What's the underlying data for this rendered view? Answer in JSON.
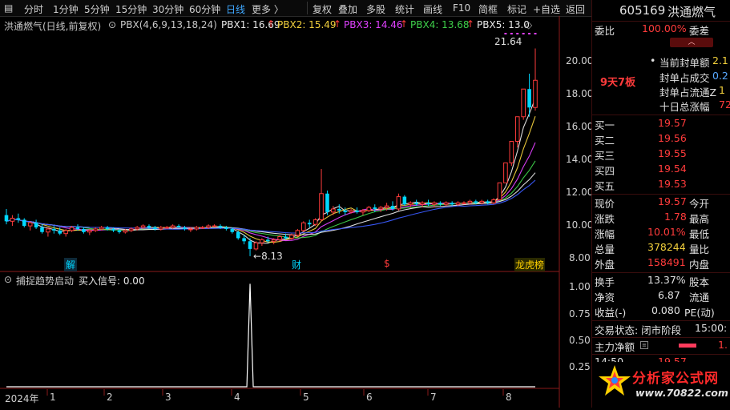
{
  "toolbar": {
    "left_items": [
      "分时",
      "1分钟",
      "5分钟",
      "15分钟",
      "30分钟",
      "60分钟",
      "日线",
      "更多 〉"
    ],
    "active_index": 6,
    "right_items": [
      "复权",
      "叠加",
      "多股",
      "统计",
      "画线",
      "F10",
      "简框",
      "标记",
      "+自选",
      "返回"
    ]
  },
  "main_header": {
    "title": "洪通燃气(日线,前复权)",
    "formula": "PBX(4,6,9,13,18,24)",
    "pbx": [
      {
        "label": "PBX1: 16.69",
        "color": "#e8e8e8"
      },
      {
        "label": "PBX2: 15.49",
        "color": "#f2d03c"
      },
      {
        "label": "PBX3: 14.46",
        "color": "#e040ff"
      },
      {
        "label": "PBX4: 13.68",
        "color": "#3ecf4a"
      },
      {
        "label": "PBX5: 13.0",
        "color": "#e8e8e8"
      }
    ]
  },
  "price_axis": {
    "ticks": [
      "20.00",
      "18.00",
      "16.00",
      "14.00",
      "12.00",
      "10.00",
      "8.00"
    ]
  },
  "annotations": {
    "high": "21.64",
    "low": "8.13"
  },
  "event_markers": [
    {
      "text": "解",
      "color": "#00d8ff"
    },
    {
      "text": "财",
      "color": "#00d8ff"
    },
    {
      "text": "$",
      "color": "#ff3b3b"
    },
    {
      "text": "龙虎榜",
      "color": "#ffd000"
    }
  ],
  "sub_header": {
    "title": "捕捉趋势启动",
    "signal": "买入信号: 0.00"
  },
  "sub_axis": {
    "ticks": [
      "1.00",
      "0.75",
      "0.50",
      "0.25"
    ]
  },
  "date_axis": {
    "ticks": [
      "2024年",
      "1",
      "2",
      "3",
      "4",
      "5",
      "6",
      "7",
      "8"
    ]
  },
  "panel": {
    "code": "605169",
    "name": "洪通燃气",
    "weibi_label": "委比",
    "weibi_value": "100.00%",
    "weicha_label": "委差",
    "streak": "9天7板",
    "limit_rows": [
      {
        "label": "当前封单额",
        "value": "2.1"
      },
      {
        "label": "封单占成交",
        "value": "0.2"
      },
      {
        "label": "封单占流通Z",
        "value": "1"
      },
      {
        "label": "十日总涨幅",
        "value": "72"
      }
    ],
    "bids": [
      {
        "label": "买一",
        "price": "19.57"
      },
      {
        "label": "买二",
        "price": "19.56"
      },
      {
        "label": "买三",
        "price": "19.55"
      },
      {
        "label": "买四",
        "price": "19.54"
      },
      {
        "label": "买五",
        "price": "19.53"
      }
    ],
    "quote": [
      {
        "l1": "现价",
        "v1": "19.57",
        "l2": "今开",
        "c": "red"
      },
      {
        "l1": "涨跌",
        "v1": "1.78",
        "l2": "最高",
        "c": "red"
      },
      {
        "l1": "涨幅",
        "v1": "10.01%",
        "l2": "最低",
        "c": "red"
      },
      {
        "l1": "总量",
        "v1": "378244",
        "l2": "量比",
        "c": "yel"
      },
      {
        "l1": "外盘",
        "v1": "158491",
        "l2": "内盘",
        "c": "red"
      }
    ],
    "stats": [
      {
        "l1": "换手",
        "v1": "13.37%",
        "l2": "股本"
      },
      {
        "l1": "净资",
        "v1": "6.87",
        "l2": "流通"
      },
      {
        "l1": "收益(-)",
        "v1": "0.080",
        "l2": "PE(动)"
      }
    ],
    "status_label": "交易状态: 闭市阶段",
    "status_time": "15:00:",
    "net_label": "主力净额",
    "net_value": "1.",
    "bottom_time": "14:50",
    "bottom_price": "19.57"
  },
  "watermark": {
    "main": "分析家公式网",
    "url": "www.70822.com"
  },
  "colors": {
    "up": "#ff3b3b",
    "down": "#00d8ff",
    "bg": "#000000",
    "grid": "#3a0d0d"
  },
  "chart_data": {
    "type": "candlestick",
    "title": "洪通燃气(日线,前复权)",
    "ylim": [
      7.5,
      22.5
    ],
    "x_ticks": [
      "2024年",
      "1",
      "2",
      "3",
      "4",
      "5",
      "6",
      "7",
      "8"
    ],
    "ohlc": [
      [
        10.8,
        11.2,
        10.2,
        10.4
      ],
      [
        10.4,
        10.8,
        10.1,
        10.6
      ],
      [
        10.6,
        10.9,
        10.3,
        10.5
      ],
      [
        10.5,
        10.6,
        10.0,
        10.1
      ],
      [
        10.1,
        10.4,
        9.8,
        10.3
      ],
      [
        10.3,
        10.5,
        9.9,
        10.0
      ],
      [
        10.0,
        10.2,
        9.6,
        9.7
      ],
      [
        9.7,
        10.0,
        9.4,
        9.9
      ],
      [
        9.9,
        10.1,
        9.6,
        9.8
      ],
      [
        9.8,
        10.0,
        9.5,
        9.6
      ],
      [
        9.6,
        9.9,
        9.4,
        9.8
      ],
      [
        9.8,
        10.1,
        9.7,
        10.0
      ],
      [
        10.0,
        10.2,
        9.8,
        9.9
      ],
      [
        9.9,
        10.0,
        9.6,
        9.7
      ],
      [
        9.7,
        9.9,
        9.5,
        9.8
      ],
      [
        9.8,
        10.0,
        9.7,
        9.9
      ],
      [
        9.9,
        10.1,
        9.8,
        10.0
      ],
      [
        10.0,
        10.1,
        9.8,
        9.9
      ],
      [
        9.9,
        10.0,
        9.7,
        9.8
      ],
      [
        9.8,
        9.9,
        9.6,
        9.7
      ],
      [
        9.7,
        9.9,
        9.6,
        9.8
      ],
      [
        9.8,
        10.0,
        9.7,
        9.9
      ],
      [
        9.9,
        10.1,
        9.8,
        10.0
      ],
      [
        10.0,
        10.2,
        9.9,
        10.1
      ],
      [
        10.1,
        10.2,
        9.9,
        10.0
      ],
      [
        10.0,
        10.1,
        9.8,
        9.9
      ],
      [
        9.9,
        10.1,
        9.8,
        10.0
      ],
      [
        10.0,
        10.1,
        9.9,
        10.0
      ],
      [
        10.0,
        10.2,
        9.9,
        10.1
      ],
      [
        10.1,
        10.2,
        10.0,
        10.0
      ],
      [
        10.0,
        10.1,
        9.8,
        9.9
      ],
      [
        9.9,
        10.0,
        9.7,
        9.9
      ],
      [
        9.9,
        10.1,
        9.8,
        10.0
      ],
      [
        10.0,
        10.1,
        9.9,
        10.0
      ],
      [
        10.0,
        10.2,
        9.9,
        10.1
      ],
      [
        10.1,
        10.2,
        10.0,
        10.1
      ],
      [
        10.1,
        10.2,
        9.9,
        10.0
      ],
      [
        10.0,
        10.1,
        9.8,
        9.9
      ],
      [
        9.9,
        10.0,
        9.6,
        9.7
      ],
      [
        9.7,
        9.8,
        9.2,
        9.3
      ],
      [
        9.3,
        9.5,
        8.9,
        9.1
      ],
      [
        9.1,
        9.3,
        8.13,
        8.6
      ],
      [
        8.6,
        9.1,
        8.5,
        9.0
      ],
      [
        9.0,
        9.3,
        8.8,
        9.2
      ],
      [
        9.2,
        9.4,
        9.0,
        9.1
      ],
      [
        9.1,
        9.3,
        8.9,
        9.2
      ],
      [
        9.2,
        9.5,
        9.1,
        9.4
      ],
      [
        9.4,
        9.6,
        9.2,
        9.3
      ],
      [
        9.3,
        9.6,
        9.2,
        9.5
      ],
      [
        9.5,
        9.9,
        9.4,
        9.8
      ],
      [
        9.8,
        10.4,
        9.7,
        10.3
      ],
      [
        10.3,
        10.5,
        10.0,
        10.2
      ],
      [
        10.2,
        10.6,
        10.1,
        10.5
      ],
      [
        10.5,
        13.8,
        10.4,
        12.2
      ],
      [
        12.2,
        12.4,
        10.8,
        11.0
      ],
      [
        11.0,
        11.4,
        10.8,
        11.2
      ],
      [
        11.2,
        11.5,
        10.9,
        11.1
      ],
      [
        11.1,
        11.3,
        10.8,
        11.0
      ],
      [
        11.0,
        11.2,
        10.9,
        11.1
      ],
      [
        11.1,
        11.3,
        10.9,
        11.0
      ],
      [
        11.0,
        11.2,
        10.8,
        11.1
      ],
      [
        11.1,
        11.4,
        11.0,
        11.3
      ],
      [
        11.3,
        11.5,
        11.0,
        11.2
      ],
      [
        11.2,
        11.4,
        11.0,
        11.3
      ],
      [
        11.3,
        11.6,
        11.1,
        11.4
      ],
      [
        11.4,
        11.7,
        11.1,
        11.2
      ],
      [
        11.2,
        12.2,
        11.1,
        12.0
      ],
      [
        12.0,
        12.1,
        11.4,
        11.5
      ],
      [
        11.5,
        11.7,
        11.3,
        11.6
      ],
      [
        11.6,
        11.8,
        11.4,
        11.5
      ],
      [
        11.5,
        11.7,
        11.3,
        11.6
      ],
      [
        11.6,
        11.8,
        11.4,
        11.5
      ],
      [
        11.5,
        11.7,
        11.3,
        11.6
      ],
      [
        11.6,
        11.7,
        11.4,
        11.5
      ],
      [
        11.5,
        11.7,
        11.4,
        11.6
      ],
      [
        11.6,
        11.7,
        11.4,
        11.5
      ],
      [
        11.5,
        11.7,
        11.4,
        11.6
      ],
      [
        11.6,
        11.7,
        11.5,
        11.6
      ],
      [
        11.6,
        11.8,
        11.5,
        11.7
      ],
      [
        11.7,
        11.8,
        11.5,
        11.6
      ],
      [
        11.6,
        11.8,
        11.5,
        11.7
      ],
      [
        11.7,
        11.8,
        11.5,
        11.6
      ],
      [
        11.6,
        11.9,
        11.5,
        11.8
      ],
      [
        11.8,
        12.9,
        11.8,
        12.9
      ],
      [
        12.9,
        14.2,
        12.9,
        14.2
      ],
      [
        14.2,
        15.6,
        14.0,
        15.6
      ],
      [
        15.6,
        17.2,
        15.2,
        17.2
      ],
      [
        17.2,
        19.0,
        17.0,
        19.0
      ],
      [
        19.0,
        20.0,
        17.2,
        17.8
      ],
      [
        17.8,
        21.64,
        17.6,
        19.57
      ]
    ],
    "ma": [
      {
        "name": "PBX1",
        "color": "#e8e8e8",
        "last": 16.69
      },
      {
        "name": "PBX2",
        "color": "#f2d03c",
        "last": 15.49
      },
      {
        "name": "PBX3",
        "color": "#e040ff",
        "last": 14.46
      },
      {
        "name": "PBX4",
        "color": "#3ecf4a",
        "last": 13.68
      },
      {
        "name": "PBX5",
        "color": "#e8e8e8",
        "last": 13.0
      },
      {
        "name": "PBX6",
        "color": "#3a5bff",
        "last": 12.5
      }
    ],
    "signal": {
      "ylim": [
        0,
        1.05
      ],
      "spike_index": 41,
      "value": 1.0
    }
  }
}
